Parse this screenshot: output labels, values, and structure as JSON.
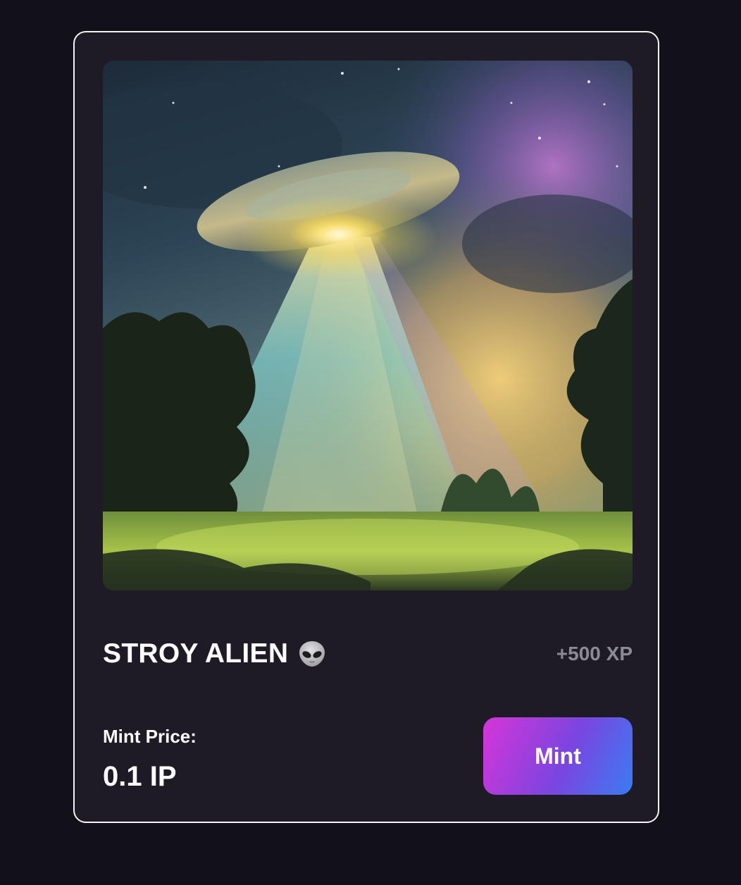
{
  "card": {
    "title": "STROY ALIEN",
    "title_icon": "alien-icon",
    "xp_reward": "+500 XP",
    "price_label": "Mint Price:",
    "price_value": "0.1 IP",
    "mint_label": "Mint",
    "artwork_subject": "ufo-beam-over-forest-artwork"
  },
  "colors": {
    "page_background": "#121019",
    "card_background": "#1e1b27",
    "card_border": "#f4f4f6",
    "xp_text": "#8c8a95",
    "mint_gradient": [
      "#d635d8",
      "#7a45e0",
      "#3b7cf2"
    ]
  }
}
